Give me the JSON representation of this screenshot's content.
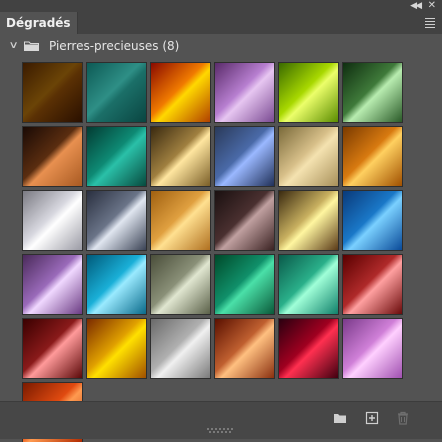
{
  "panel": {
    "tab_label": "Dégradés",
    "collapse_icon": "double-chevron-left-icon",
    "close_icon": "close-icon",
    "menu_icon": "hamburger-menu-icon"
  },
  "group": {
    "label": "Pierres-precieuses (8)",
    "expanded": true,
    "chevron_icon": "chevron-down-icon",
    "folder_icon": "folder-icon"
  },
  "gradients": [
    [
      "#3b1b00",
      "#6b4407",
      "#5a3004",
      "#2a1000"
    ],
    [
      "#0d5a55",
      "#2e8f86",
      "#1b6f68",
      "#0a4541"
    ],
    [
      "#8a0a00",
      "#f07a00",
      "#ffd800",
      "#b04000"
    ],
    [
      "#5a2b6a",
      "#b77fd0",
      "#e7c6f1",
      "#7a4a92"
    ],
    [
      "#3a6a00",
      "#a8d800",
      "#ecff6a",
      "#5a8c00"
    ],
    [
      "#0f2e10",
      "#3f7a3a",
      "#b8ecb0",
      "#2a5a28"
    ],
    [
      "#1a0a05",
      "#5a2d10",
      "#e89050",
      "#a85a22"
    ],
    [
      "#033c33",
      "#0e8a74",
      "#2ac0a8",
      "#074a3e"
    ],
    [
      "#3a2a10",
      "#a08040",
      "#ffe6a0",
      "#7a5e28"
    ],
    [
      "#2a3a5a",
      "#4a6aa8",
      "#9ab8ff",
      "#203058"
    ],
    [
      "#7a6a3a",
      "#d8c08a",
      "#f4e2b0",
      "#a8905a"
    ],
    [
      "#7a3a00",
      "#d87a10",
      "#ffd060",
      "#a05000"
    ],
    [
      "#7a7a82",
      "#d8d8e0",
      "#ffffff",
      "#9a9aa4"
    ],
    [
      "#2a3040",
      "#6a7488",
      "#e0e6f0",
      "#3a4254"
    ],
    [
      "#a06010",
      "#e0a040",
      "#ffe090",
      "#b07020"
    ],
    [
      "#1a1010",
      "#4a3030",
      "#c0a0a0",
      "#3a2222"
    ],
    [
      "#3a2a10",
      "#c8b060",
      "#fff6a0",
      "#5a3a18"
    ],
    [
      "#0a3a7a",
      "#1a78c8",
      "#7ad0ff",
      "#0a4a98"
    ],
    [
      "#4a2a5a",
      "#9a6aba",
      "#f0d8ff",
      "#6a3a82"
    ],
    [
      "#005a7a",
      "#1ab0d8",
      "#9aeaff",
      "#0a6a8a"
    ],
    [
      "#4a4e3a",
      "#8a9078",
      "#e0e6d0",
      "#5a6048"
    ],
    [
      "#004a2a",
      "#10906a",
      "#4ae0a8",
      "#0a5a3a"
    ],
    [
      "#0a5a4a",
      "#2ab08a",
      "#a0ffd8",
      "#10806a"
    ],
    [
      "#5a0000",
      "#b02a2a",
      "#ffa0a0",
      "#6a0a0a"
    ],
    [
      "#3a0000",
      "#8a1a1a",
      "#ff9a9a",
      "#5a0808"
    ],
    [
      "#7a2a00",
      "#e0a000",
      "#ffe000",
      "#a05000"
    ],
    [
      "#6a6a6a",
      "#b0b0b0",
      "#f0f0f0",
      "#7a7a7a"
    ],
    [
      "#5a1000",
      "#c06030",
      "#ffc080",
      "#8a3010"
    ],
    [
      "#2a0010",
      "#a00020",
      "#ff3050",
      "#400010"
    ],
    [
      "#7a3a8a",
      "#d080d8",
      "#ffd0ff",
      "#a050b0"
    ],
    [
      "#7a1a00",
      "#e04a10",
      "#ff9a50",
      "#b02a00"
    ]
  ],
  "footer": {
    "new_group_icon": "folder-icon",
    "new_gradient_icon": "add-square-icon",
    "delete_icon": "trash-icon"
  }
}
